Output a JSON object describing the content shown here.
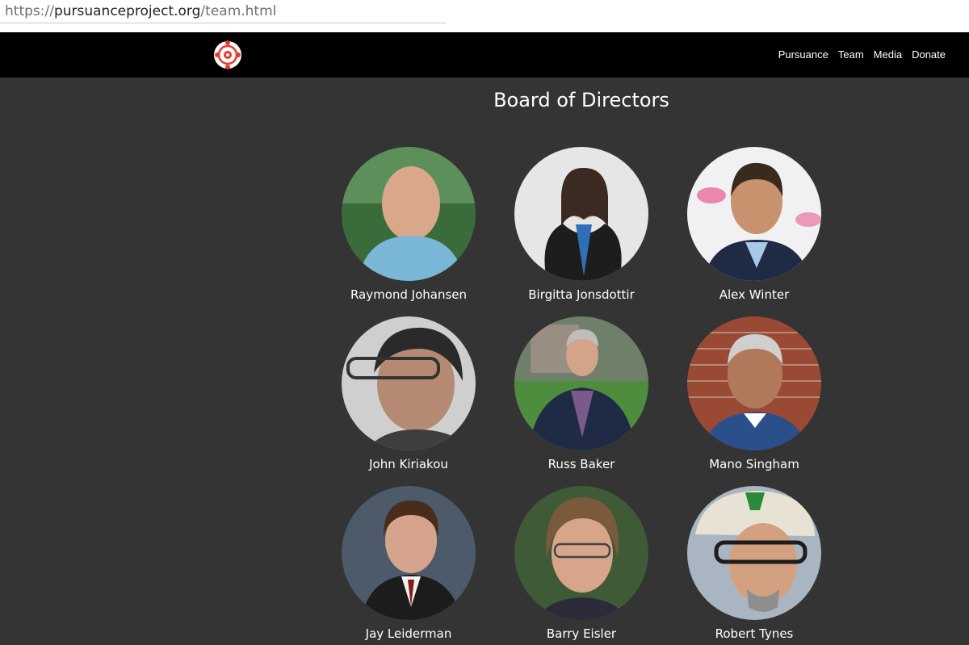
{
  "browser": {
    "url_scheme": "https://",
    "url_domain": "pursuanceproject.org",
    "url_path": "/team.html"
  },
  "nav": {
    "logo_icon": "pursuance-logo-icon",
    "links": [
      "Pursuance",
      "Team",
      "Media",
      "Donate"
    ]
  },
  "colors": {
    "background": "#343434",
    "navbar": "#000000",
    "accent": "#e8382c"
  },
  "section": {
    "title": "Board of Directors",
    "members": [
      {
        "name": "Raymond Johansen"
      },
      {
        "name": "Birgitta Jonsdottir"
      },
      {
        "name": "Alex Winter"
      },
      {
        "name": "John Kiriakou"
      },
      {
        "name": "Russ Baker"
      },
      {
        "name": "Mano Singham"
      },
      {
        "name": "Jay Leiderman"
      },
      {
        "name": "Barry Eisler"
      },
      {
        "name": "Robert Tynes"
      }
    ]
  }
}
